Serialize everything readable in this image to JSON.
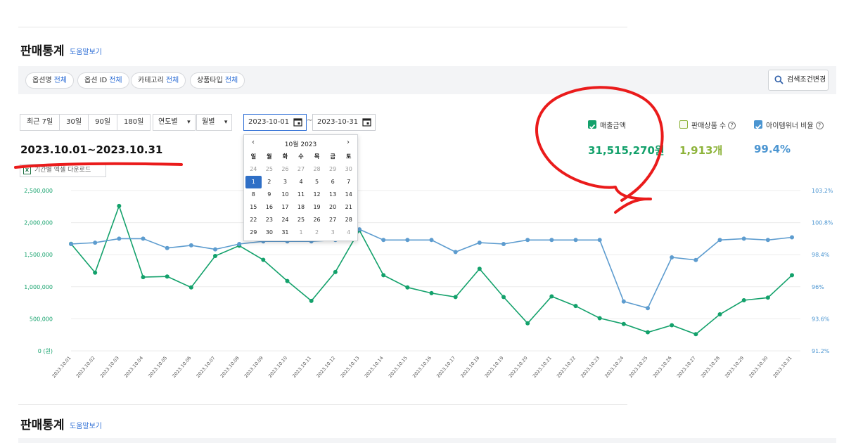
{
  "section": {
    "title": "판매통계",
    "help": "도움말보기"
  },
  "filters": [
    {
      "label": "옵션명",
      "value": "전체"
    },
    {
      "label": "옵션 ID",
      "value": "전체"
    },
    {
      "label": "카테고리",
      "value": "전체"
    },
    {
      "label": "상품타입",
      "value": "전체"
    }
  ],
  "search_button": "검색조건변경",
  "periods": [
    "최근 7일",
    "30일",
    "90일",
    "180일"
  ],
  "dropdowns": {
    "year": "연도별",
    "month": "월별"
  },
  "date_range": {
    "start": "2023-10-01",
    "end": "2023-10-31",
    "separator": "~"
  },
  "range_title": "2023.10.01~2023.10.31",
  "excel_button": "기간별 엑셀 다운로드",
  "metrics": [
    {
      "label": "매출금액",
      "value": "31,515,270원",
      "color": "#13a16b",
      "checked": true
    },
    {
      "label": "판매상품 수",
      "value": "1,913개",
      "color": "#8db33a",
      "checked": false
    },
    {
      "label": "아이템위너 비율",
      "value": "99.4%",
      "color": "#4b95d1",
      "checked": true
    }
  ],
  "calendar": {
    "month_label": "10월 2023",
    "prev": "‹",
    "next": "›",
    "weekdays": [
      "일",
      "월",
      "화",
      "수",
      "목",
      "금",
      "토"
    ],
    "days": [
      "24",
      "25",
      "26",
      "27",
      "28",
      "29",
      "30",
      "1",
      "2",
      "3",
      "4",
      "5",
      "6",
      "7",
      "8",
      "9",
      "10",
      "11",
      "12",
      "13",
      "14",
      "15",
      "16",
      "17",
      "18",
      "19",
      "20",
      "21",
      "22",
      "23",
      "24",
      "25",
      "26",
      "27",
      "28",
      "29",
      "30",
      "31",
      "1",
      "2",
      "3",
      "4"
    ],
    "muted_indices": [
      0,
      1,
      2,
      3,
      4,
      5,
      6,
      38,
      39,
      40,
      41
    ],
    "selected_index": 7
  },
  "chart_data": {
    "type": "line",
    "x": [
      "2023.10.01",
      "2023.10.02",
      "2023.10.03",
      "2023.10.04",
      "2023.10.05",
      "2023.10.06",
      "2023.10.07",
      "2023.10.08",
      "2023.10.09",
      "2023.10.10",
      "2023.10.11",
      "2023.10.12",
      "2023.10.13",
      "2023.10.14",
      "2023.10.15",
      "2023.10.16",
      "2023.10.17",
      "2023.10.18",
      "2023.10.19",
      "2023.10.20",
      "2023.10.21",
      "2023.10.22",
      "2023.10.23",
      "2023.10.24",
      "2023.10.25",
      "2023.10.26",
      "2023.10.27",
      "2023.10.28",
      "2023.10.29",
      "2023.10.30",
      "2023.10.31"
    ],
    "left_axis": {
      "ticks": [
        "0 (원)",
        "500,000",
        "1,000,000",
        "1,500,000",
        "2,000,000",
        "2,500,000"
      ],
      "min": 0,
      "max": 2500000
    },
    "right_axis": {
      "ticks": [
        "91.2%",
        "93.6%",
        "96%",
        "98.4%",
        "100.8%",
        "103.2%"
      ],
      "min": 91.2,
      "max": 103.2
    },
    "series": [
      {
        "name": "매출금액",
        "axis": "left",
        "color": "#13a16b",
        "values": [
          1670000,
          1220000,
          2260000,
          1150000,
          1160000,
          990000,
          1480000,
          1640000,
          1420000,
          1090000,
          780000,
          1230000,
          1880000,
          1180000,
          990000,
          900000,
          840000,
          1280000,
          840000,
          430000,
          850000,
          700000,
          510000,
          420000,
          290000,
          400000,
          260000,
          570000,
          790000,
          830000,
          1180000
        ]
      },
      {
        "name": "아이템위너 비율",
        "axis": "right",
        "color": "#5d9ccf",
        "values": [
          99.2,
          99.3,
          99.6,
          99.6,
          98.9,
          99.1,
          98.8,
          99.2,
          99.4,
          99.4,
          99.4,
          99.5,
          100.3,
          99.5,
          99.5,
          99.5,
          98.6,
          99.3,
          99.2,
          99.5,
          99.5,
          99.5,
          99.5,
          94.9,
          94.4,
          98.2,
          98.0,
          99.5,
          99.6,
          99.5,
          99.7
        ]
      }
    ],
    "grid": true
  },
  "second_section": {
    "title": "판매통계",
    "help": "도움말보기"
  }
}
